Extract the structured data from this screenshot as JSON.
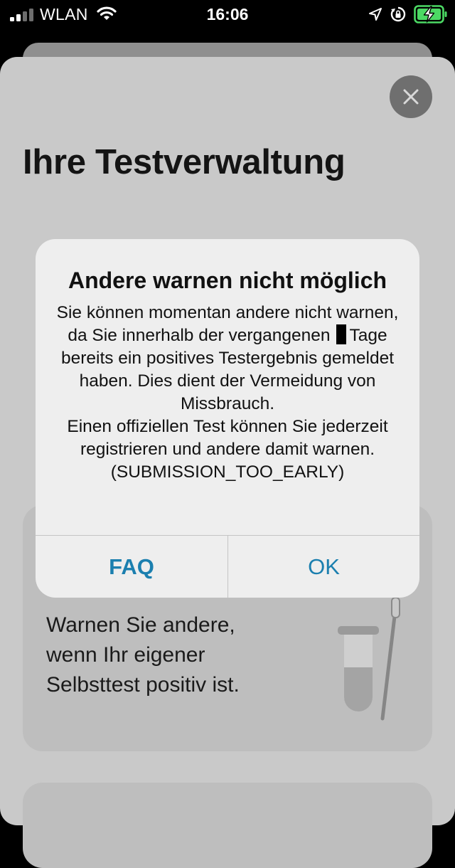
{
  "status_bar": {
    "carrier": "WLAN",
    "time": "16:06"
  },
  "header": {
    "title": "Ihre Testverwaltung"
  },
  "card": {
    "text_line_1": "Warnen Sie andere,",
    "text_line_2": "wenn Ihr eigener",
    "text_line_3": "Selbsttest positiv ist."
  },
  "alert": {
    "title": "Andere warnen nicht möglich",
    "message_part_1": "Sie können momentan andere nicht warnen, da Sie innerhalb der vergangenen",
    "message_part_2": "Tage bereits ein positives Testergebnis gemeldet haben. Dies dient der Vermeidung von Missbrauch.",
    "message_part_3": "Einen offiziellen Test können Sie jederzeit registrieren und andere damit warnen. (SUBMISSION_TOO_EARLY)",
    "faq_label": "FAQ",
    "ok_label": "OK"
  },
  "colors": {
    "accent": "#1b7faf",
    "battery_charging": "#4cd964"
  },
  "icons": {
    "wifi": "wifi-icon",
    "location": "location-arrow-icon",
    "orientation_lock": "orientation-lock-icon",
    "battery": "battery-charging-icon",
    "close": "close-icon"
  }
}
